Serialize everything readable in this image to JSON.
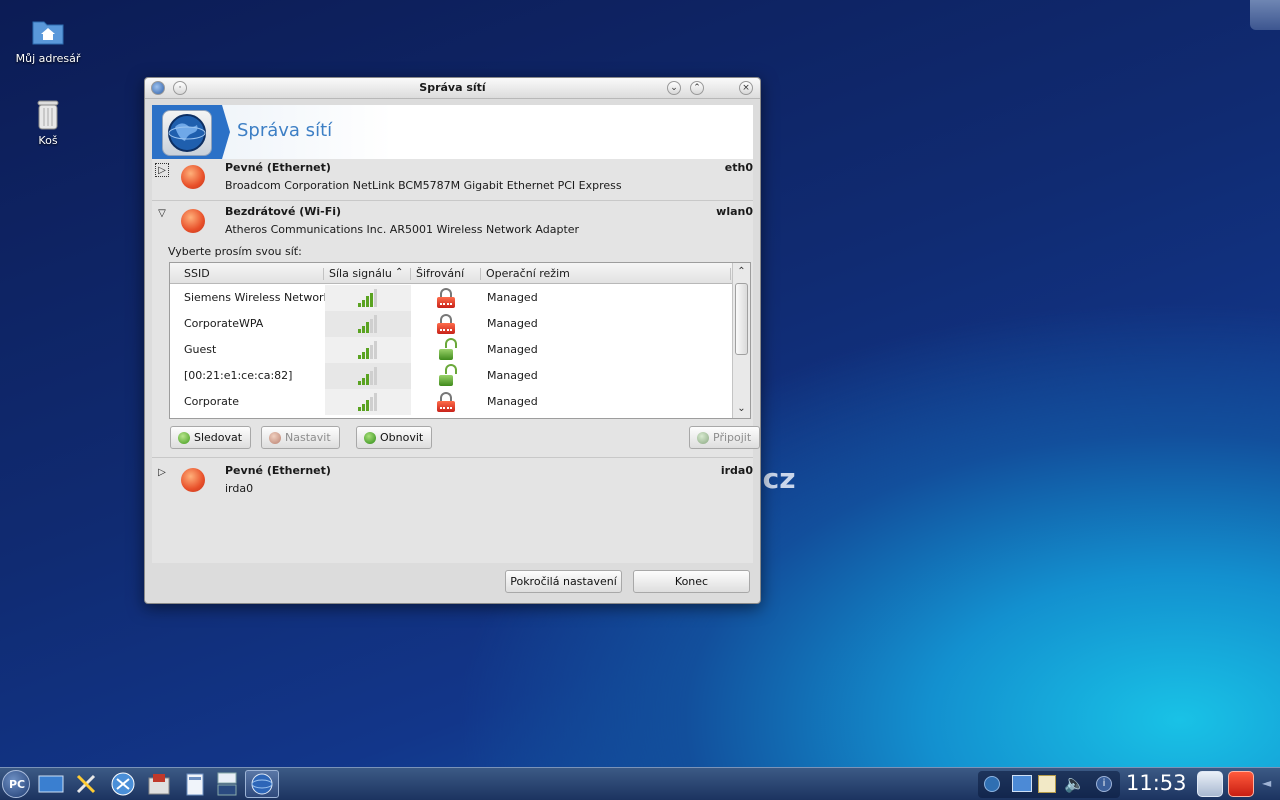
{
  "desktop": {
    "icons": [
      {
        "label": "Můj adresář",
        "icon": "home-folder-icon"
      },
      {
        "label": "Koš",
        "icon": "trash-icon"
      }
    ],
    "watermark": ".cz"
  },
  "window": {
    "title": "Správa sítí",
    "header_title": "Správa sítí",
    "devices": [
      {
        "name": "Pevné (Ethernet)",
        "description": "Broadcom Corporation NetLink BCM5787M Gigabit Ethernet PCI Express",
        "interface": "eth0",
        "expanded": false
      },
      {
        "name": "Bezdrátové (Wi-Fi)",
        "description": "Atheros Communications Inc. AR5001 Wireless Network Adapter",
        "interface": "wlan0",
        "expanded": true
      },
      {
        "name": "Pevné (Ethernet)",
        "description": "irda0",
        "interface": "irda0",
        "expanded": false
      }
    ],
    "wifi": {
      "prompt": "Vyberte prosím svou síť:",
      "columns": {
        "ssid": "SSID",
        "signal": "Síla signálu",
        "encryption": "Šifrování",
        "mode": "Operační režim"
      },
      "sort_indicator": "^",
      "networks": [
        {
          "ssid": "Siemens Wireless Network",
          "signal_bars": 4,
          "encrypted": true,
          "encryption_icon": "lock-closed-icon",
          "mode": "Managed"
        },
        {
          "ssid": "CorporateWPA",
          "signal_bars": 3,
          "encrypted": true,
          "encryption_icon": "lock-closed-icon",
          "mode": "Managed"
        },
        {
          "ssid": "Guest",
          "signal_bars": 3,
          "encrypted": false,
          "encryption_icon": "lock-open-icon",
          "mode": "Managed"
        },
        {
          "ssid": "[00:21:e1:ce:ca:82]",
          "signal_bars": 3,
          "encrypted": false,
          "encryption_icon": "lock-open-icon",
          "mode": "Managed"
        },
        {
          "ssid": "Corporate",
          "signal_bars": 3,
          "encrypted": true,
          "encryption_icon": "lock-closed-icon",
          "mode": "Managed"
        }
      ],
      "buttons": {
        "monitor": "Sledovat",
        "configure": "Nastavit",
        "refresh": "Obnovit",
        "connect": "Připojit"
      }
    },
    "footer": {
      "advanced": "Pokročilá nastavení",
      "close": "Konec"
    }
  },
  "taskbar": {
    "start_label": "PC",
    "clock": "11:53"
  },
  "colors": {
    "accent_blue": "#3d7fc5",
    "signal_green": "#5aa321",
    "lock_red": "#c8221a"
  }
}
